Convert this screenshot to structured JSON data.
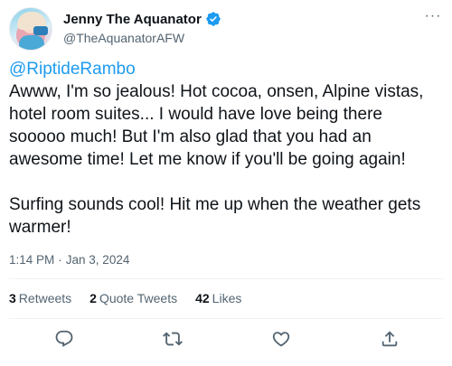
{
  "author": {
    "display_name": "Jenny The Aquanator",
    "handle": "@TheAquanatorAFW",
    "verified": true
  },
  "more_label": "···",
  "tweet": {
    "mention": "@RiptideRambo",
    "line1": "Awww, I'm so jealous! Hot cocoa, onsen, Alpine vistas, hotel room suites... I would have love being there sooooo much! But I'm also glad that you had an awesome time! Let me know if you'll be going again!",
    "line2": "Surfing sounds cool! Hit me up when the weather gets warmer!"
  },
  "meta": {
    "time": "1:14 PM",
    "separator": "·",
    "date": "Jan 3, 2024"
  },
  "stats": {
    "retweets_count": "3",
    "retweets_label": "Retweets",
    "quotes_count": "2",
    "quotes_label": "Quote Tweets",
    "likes_count": "42",
    "likes_label": "Likes"
  },
  "colors": {
    "accent": "#1d9bf0",
    "text": "#0f1419",
    "secondary": "#536471",
    "divider": "#eff3f4"
  },
  "icons": [
    "verified-badge-icon",
    "more-icon",
    "reply-icon",
    "retweet-icon",
    "like-icon",
    "share-icon"
  ]
}
